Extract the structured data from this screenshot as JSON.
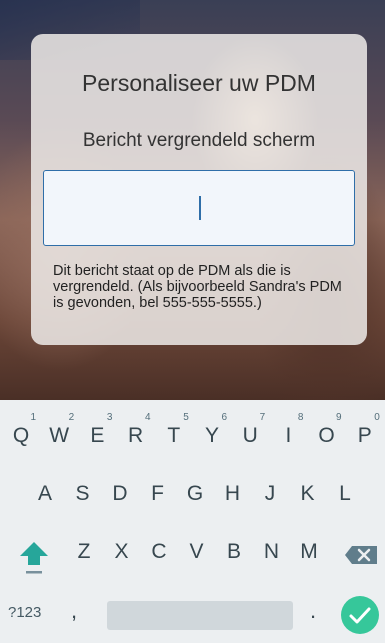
{
  "dialog": {
    "title": "Personaliseer uw PDM",
    "subtitle": "Bericht vergrendeld scherm",
    "input_value": "",
    "helper_text": "Dit bericht staat op de PDM als die is vergrendeld. (Als bijvoorbeeld Sandra's PDM is gevonden, bel 555-555-5555.)"
  },
  "keyboard": {
    "row1": [
      {
        "label": "Q",
        "hint": "1"
      },
      {
        "label": "W",
        "hint": "2"
      },
      {
        "label": "E",
        "hint": "3"
      },
      {
        "label": "R",
        "hint": "4"
      },
      {
        "label": "T",
        "hint": "5"
      },
      {
        "label": "Y",
        "hint": "6"
      },
      {
        "label": "U",
        "hint": "7"
      },
      {
        "label": "I",
        "hint": "8"
      },
      {
        "label": "O",
        "hint": "9"
      },
      {
        "label": "P",
        "hint": "0"
      }
    ],
    "row2": [
      "A",
      "S",
      "D",
      "F",
      "G",
      "H",
      "J",
      "K",
      "L"
    ],
    "row3": [
      "Z",
      "X",
      "C",
      "V",
      "B",
      "N",
      "M"
    ],
    "symbols_label": "?123",
    "comma_label": ",",
    "period_label": ".",
    "accent_color": "#36c79a",
    "shift_color": "#26a69a",
    "icons": [
      "shift-icon",
      "backspace-icon",
      "checkmark-icon"
    ]
  }
}
